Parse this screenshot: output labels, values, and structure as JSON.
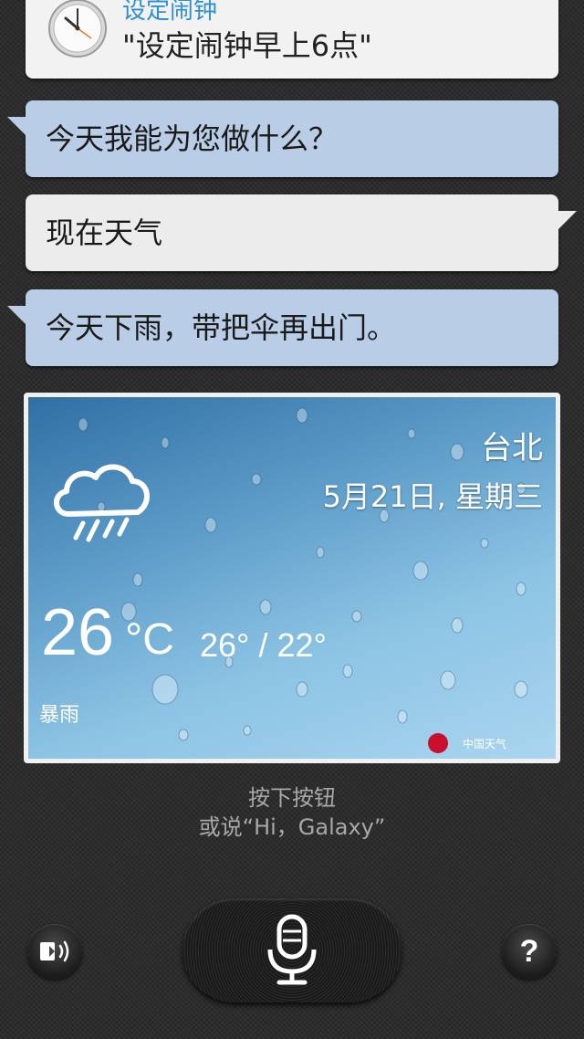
{
  "alarm": {
    "title": "设定闹钟",
    "command": "\"设定闹钟早上6点\""
  },
  "messages": [
    {
      "from": "assistant",
      "text": "今天我能为您做什么？"
    },
    {
      "from": "user",
      "text": "现在天气"
    },
    {
      "from": "assistant",
      "text": "今天下雨，带把伞再出门。"
    }
  ],
  "weather": {
    "city": "台北",
    "date": "5月21日, 星期三",
    "temp": "26",
    "unit": "°C",
    "range": "26° / 22°",
    "condition": "暴雨",
    "brand": "中国天气",
    "icon": "rain-cloud-icon"
  },
  "hint": {
    "line1": "按下按钮",
    "line2": "或说“Hi，Galaxy”"
  },
  "controls": {
    "left_icon": "speaker-icon",
    "center_icon": "microphone-icon",
    "right_icon": "help-icon",
    "help_glyph": "?"
  },
  "colors": {
    "assistant_bubble": "#b9cde6",
    "user_bubble": "#ececec",
    "alarm_title": "#2f8fd0"
  }
}
